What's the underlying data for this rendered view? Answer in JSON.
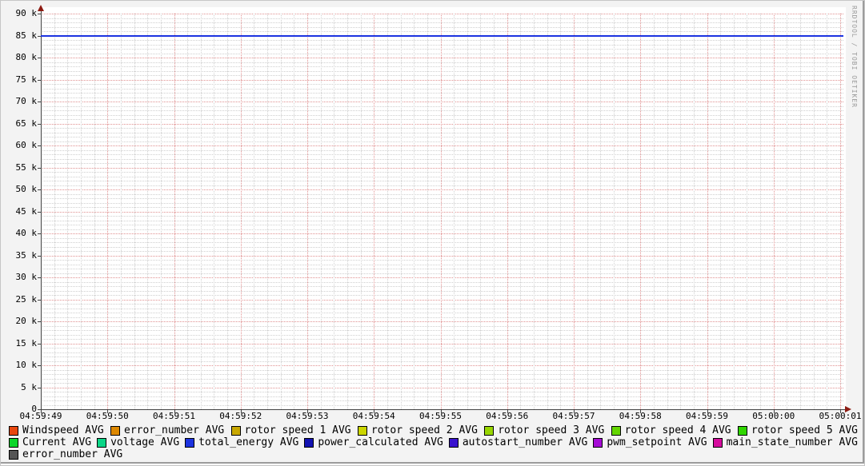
{
  "signature": "RRDTOOL / TOBI OETIKER",
  "colors": {
    "background": "#f3f3f3",
    "canvas": "#ffffff",
    "grid_minor": "#cfcfcf",
    "grid_major": "#e09090",
    "axis": "#444444",
    "arrow": "#8e1b12",
    "frame_shadow": "#9c9c9c"
  },
  "chart_data": {
    "type": "line",
    "title": "",
    "xlabel": "",
    "ylabel": "",
    "ylim": [
      0,
      90000
    ],
    "grid": true,
    "legend_position": "bottom",
    "x_ticks": [
      "04:59:49",
      "04:59:50",
      "04:59:51",
      "04:59:52",
      "04:59:53",
      "04:59:54",
      "04:59:55",
      "04:59:56",
      "04:59:57",
      "04:59:58",
      "04:59:59",
      "05:00:00",
      "05:00:01"
    ],
    "y_ticks": [
      {
        "label": "90 k",
        "v": 90
      },
      {
        "label": "85 k",
        "v": 85
      },
      {
        "label": "80 k",
        "v": 80
      },
      {
        "label": "75 k",
        "v": 75
      },
      {
        "label": "70 k",
        "v": 70
      },
      {
        "label": "65 k",
        "v": 65
      },
      {
        "label": "60 k",
        "v": 60
      },
      {
        "label": "55 k",
        "v": 55
      },
      {
        "label": "50 k",
        "v": 50
      },
      {
        "label": "45 k",
        "v": 45
      },
      {
        "label": "40 k",
        "v": 40
      },
      {
        "label": "35 k",
        "v": 35
      },
      {
        "label": "30 k",
        "v": 30
      },
      {
        "label": "25 k",
        "v": 25
      },
      {
        "label": "20 k",
        "v": 20
      },
      {
        "label": "15 k",
        "v": 15
      },
      {
        "label": "10 k",
        "v": 10
      },
      {
        "label": "5 k",
        "v": 5
      },
      {
        "label": "0",
        "v": 0
      }
    ],
    "series": [
      {
        "name": "Windspeed AVG",
        "color": "#e8470e"
      },
      {
        "name": "error_number AVG",
        "color": "#dd8800"
      },
      {
        "name": "rotor speed 1 AVG",
        "color": "#c9a800"
      },
      {
        "name": "rotor speed 2 AVG",
        "color": "#ccd600"
      },
      {
        "name": "rotor speed 3 AVG",
        "color": "#98d600"
      },
      {
        "name": "rotor speed 4 AVG",
        "color": "#64d600"
      },
      {
        "name": "rotor speed 5 AVG",
        "color": "#30d600"
      },
      {
        "name": "Current AVG",
        "color": "#0bd62a"
      },
      {
        "name": "voltage AVG",
        "color": "#0bd687"
      },
      {
        "name": "total_energy AVG",
        "color": "#1c33e0"
      },
      {
        "name": "power_calculated AVG",
        "color": "#1212b2"
      },
      {
        "name": "autostart_number AVG",
        "color": "#3912cf"
      },
      {
        "name": "pwm_setpoint AVG",
        "color": "#a50bd6"
      },
      {
        "name": "main_state_number AVG",
        "color": "#d60b9e"
      },
      {
        "name": "error_number AVG",
        "color": "#555555"
      }
    ],
    "legend_rows": [
      7,
      7,
      1
    ],
    "plotted_line": {
      "series": "total_energy AVG",
      "color": "#1c33e0",
      "value": 85000,
      "value_k": 85,
      "x_start": "04:59:49",
      "x_end": "05:00:01",
      "shape": "constant"
    }
  }
}
